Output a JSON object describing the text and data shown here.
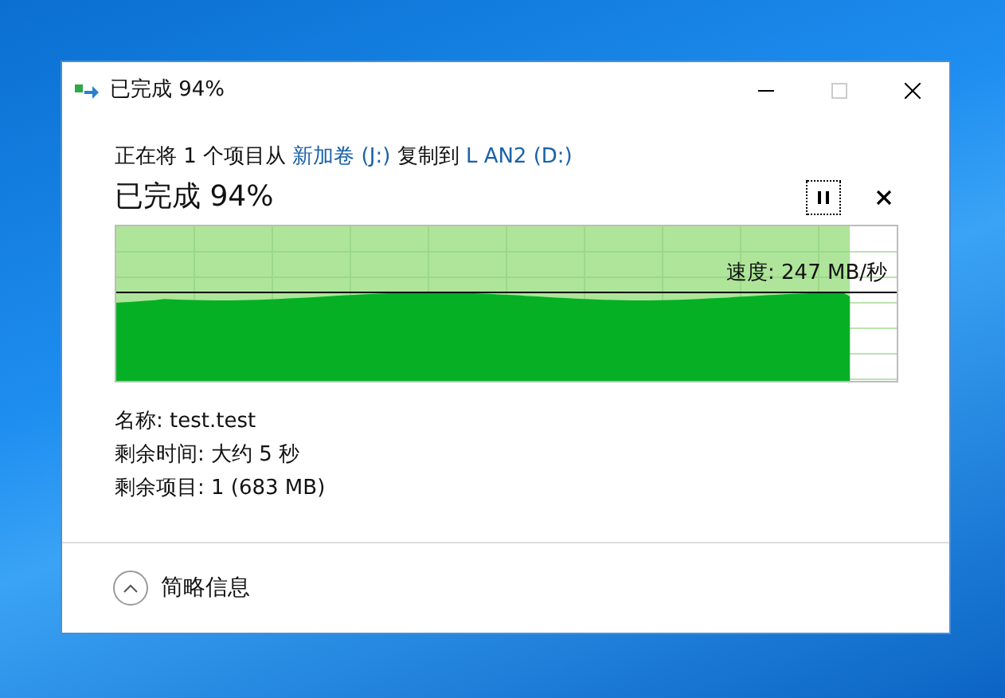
{
  "window": {
    "title": "已完成 94%"
  },
  "message": {
    "parts": [
      {
        "kind": "text",
        "text": "正在将 1 个项目从 "
      },
      {
        "kind": "link",
        "text": "新加卷 (J:)"
      },
      {
        "kind": "text",
        "text": " 复制到 "
      },
      {
        "kind": "link",
        "text": "L AN2 (D:)"
      }
    ]
  },
  "heading": "已完成 94%",
  "progress": {
    "level": 0.94,
    "speed": "速度: 247 MB/秒"
  },
  "details": [
    {
      "label": "名称:",
      "value": "test.test"
    },
    {
      "label": "剩余时间:",
      "value": "大约 5 秒"
    },
    {
      "label": "剩余项目:",
      "value": "1 (683 MB)"
    }
  ],
  "footer": {
    "toggle": "简略信息",
    "expanded": true
  }
}
